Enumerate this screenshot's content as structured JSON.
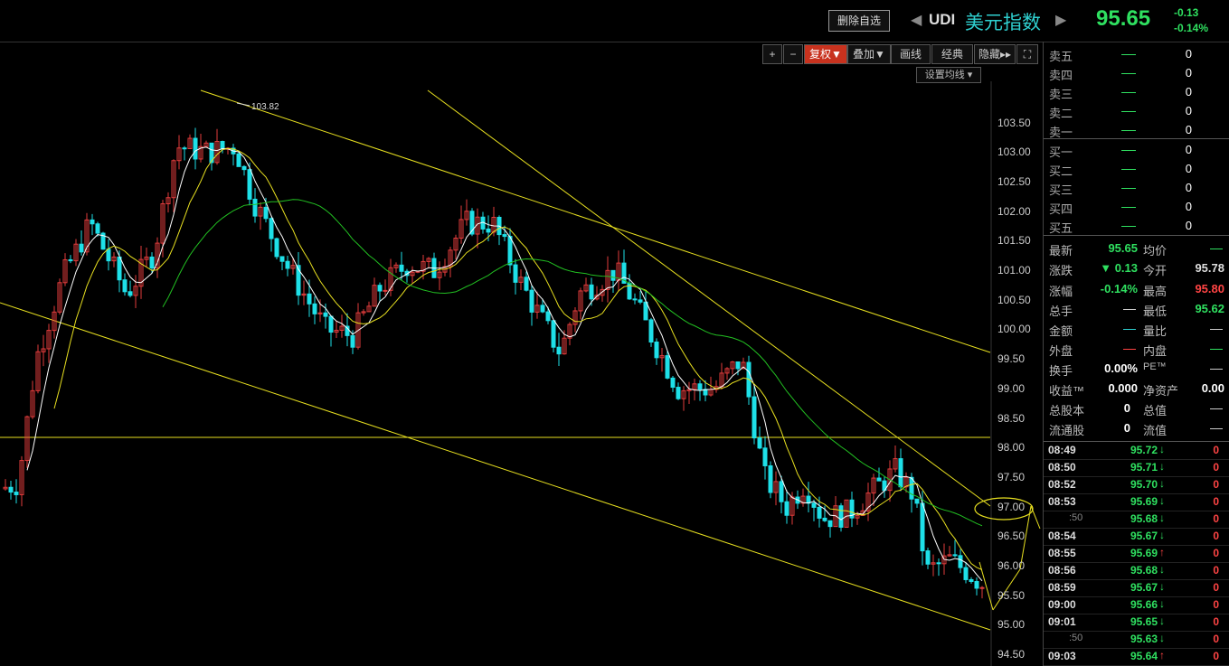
{
  "header": {
    "delete_button": "删除自选",
    "symbol": "UDI",
    "name": "美元指数",
    "price": "95.65",
    "change": "-0.13",
    "change_pct": "-0.14%",
    "up_color": "#ff4444",
    "down_color": "#2fe060"
  },
  "toolbar": {
    "plus": "+",
    "minus": "−",
    "fuquan": "复权▼",
    "overlay": "叠加▼",
    "draw": "画线",
    "classic": "经典",
    "hide": "隐藏▸▸",
    "fullscreen": "⛶",
    "set_ma": "设置均线 ▾"
  },
  "chart_data": {
    "type": "candlestick",
    "y_ticks": [
      "103.50",
      "103.00",
      "102.50",
      "102.00",
      "101.50",
      "101.00",
      "100.50",
      "100.00",
      "99.50",
      "99.00",
      "98.50",
      "98.00",
      "97.50",
      "97.00",
      "96.50",
      "96.00",
      "95.50",
      "95.00",
      "94.50"
    ],
    "ylim": [
      94.3,
      104.2
    ],
    "high_annotation": "103.82",
    "grid": false
  },
  "orderbook": {
    "asks": [
      {
        "label": "卖五",
        "price": "—",
        "qty": "0"
      },
      {
        "label": "卖四",
        "price": "—",
        "qty": "0"
      },
      {
        "label": "卖三",
        "price": "—",
        "qty": "0"
      },
      {
        "label": "卖二",
        "price": "—",
        "qty": "0"
      },
      {
        "label": "卖一",
        "price": "—",
        "qty": "0"
      }
    ],
    "bids": [
      {
        "label": "买一",
        "price": "—",
        "qty": "0"
      },
      {
        "label": "买二",
        "price": "—",
        "qty": "0"
      },
      {
        "label": "买三",
        "price": "—",
        "qty": "0"
      },
      {
        "label": "买四",
        "price": "—",
        "qty": "0"
      },
      {
        "label": "买五",
        "price": "—",
        "qty": "0"
      }
    ]
  },
  "stats": {
    "latest_l": "最新",
    "latest": "95.65",
    "avg_l": "均价",
    "chg_l": "涨跌",
    "chg": "▼ 0.13",
    "open_l": "今开",
    "open": "95.78",
    "pct_l": "涨幅",
    "pct": "-0.14%",
    "high_l": "最高",
    "high": "95.80",
    "vol_l": "总手",
    "low_l": "最低",
    "low": "95.62",
    "amt_l": "金额",
    "ratio_l": "量比",
    "outer_l": "外盘",
    "inner_l": "内盘",
    "turnover_l": "换手",
    "turnover": "0.00%",
    "pe_l": "PE™",
    "eps_l": "收益™",
    "eps": "0.000",
    "nav_l": "净资产",
    "nav": "0.00",
    "shares_l": "总股本",
    "shares": "0",
    "mcap_l": "总值",
    "float_l": "流通股",
    "float": "0",
    "fcap_l": "流值"
  },
  "ticks": [
    {
      "time": "08:49",
      "price": "95.72",
      "dir": "down",
      "vol": "0"
    },
    {
      "time": "08:50",
      "price": "95.71",
      "dir": "down",
      "vol": "0"
    },
    {
      "time": "08:52",
      "price": "95.70",
      "dir": "down",
      "vol": "0"
    },
    {
      "time": "08:53",
      "price": "95.69",
      "dir": "down",
      "vol": "0"
    },
    {
      "time": ":50",
      "price": "95.68",
      "dir": "down",
      "vol": "0",
      "sub": true
    },
    {
      "time": "08:54",
      "price": "95.67",
      "dir": "down",
      "vol": "0"
    },
    {
      "time": "08:55",
      "price": "95.69",
      "dir": "up",
      "vol": "0"
    },
    {
      "time": "08:56",
      "price": "95.68",
      "dir": "down",
      "vol": "0"
    },
    {
      "time": "08:59",
      "price": "95.67",
      "dir": "down",
      "vol": "0"
    },
    {
      "time": "09:00",
      "price": "95.66",
      "dir": "down",
      "vol": "0"
    },
    {
      "time": "09:01",
      "price": "95.65",
      "dir": "down",
      "vol": "0"
    },
    {
      "time": ":50",
      "price": "95.63",
      "dir": "down",
      "vol": "0",
      "sub": true
    },
    {
      "time": "09:03",
      "price": "95.64",
      "dir": "up",
      "vol": "0"
    }
  ]
}
